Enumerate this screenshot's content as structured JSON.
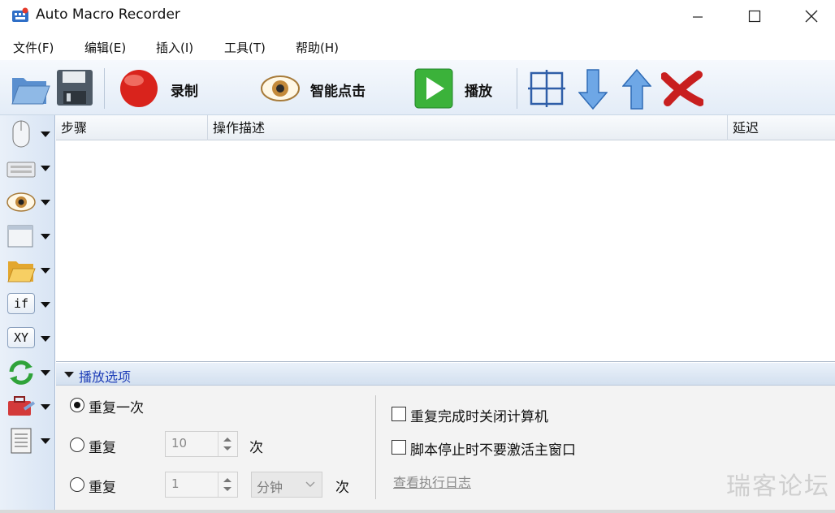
{
  "window": {
    "title": "Auto Macro Recorder"
  },
  "menu": [
    "文件(F)",
    "编辑(E)",
    "插入(I)",
    "工具(T)",
    "帮助(H)"
  ],
  "toolbar": {
    "record_label": "录制",
    "smart_click_label": "智能点击",
    "play_label": "播放"
  },
  "table": {
    "columns": [
      "步骤",
      "操作描述",
      "延迟"
    ]
  },
  "options": {
    "title": "播放选项",
    "repeat_once": "重复一次",
    "repeat_label": "重复",
    "repeat_count_value": "10",
    "times_label": "次",
    "repeat_interval_value": "1",
    "interval_unit": "分钟",
    "times_label2": "次",
    "shutdown_label": "重复完成时关闭计算机",
    "no_activate_label": "脚本停止时不要激活主窗口",
    "view_log_link": "查看执行日志"
  },
  "watermark": "瑞客论坛",
  "colors": {
    "options_title": "#1f3fb8",
    "toolbar_bg": "#e3ecf7"
  }
}
